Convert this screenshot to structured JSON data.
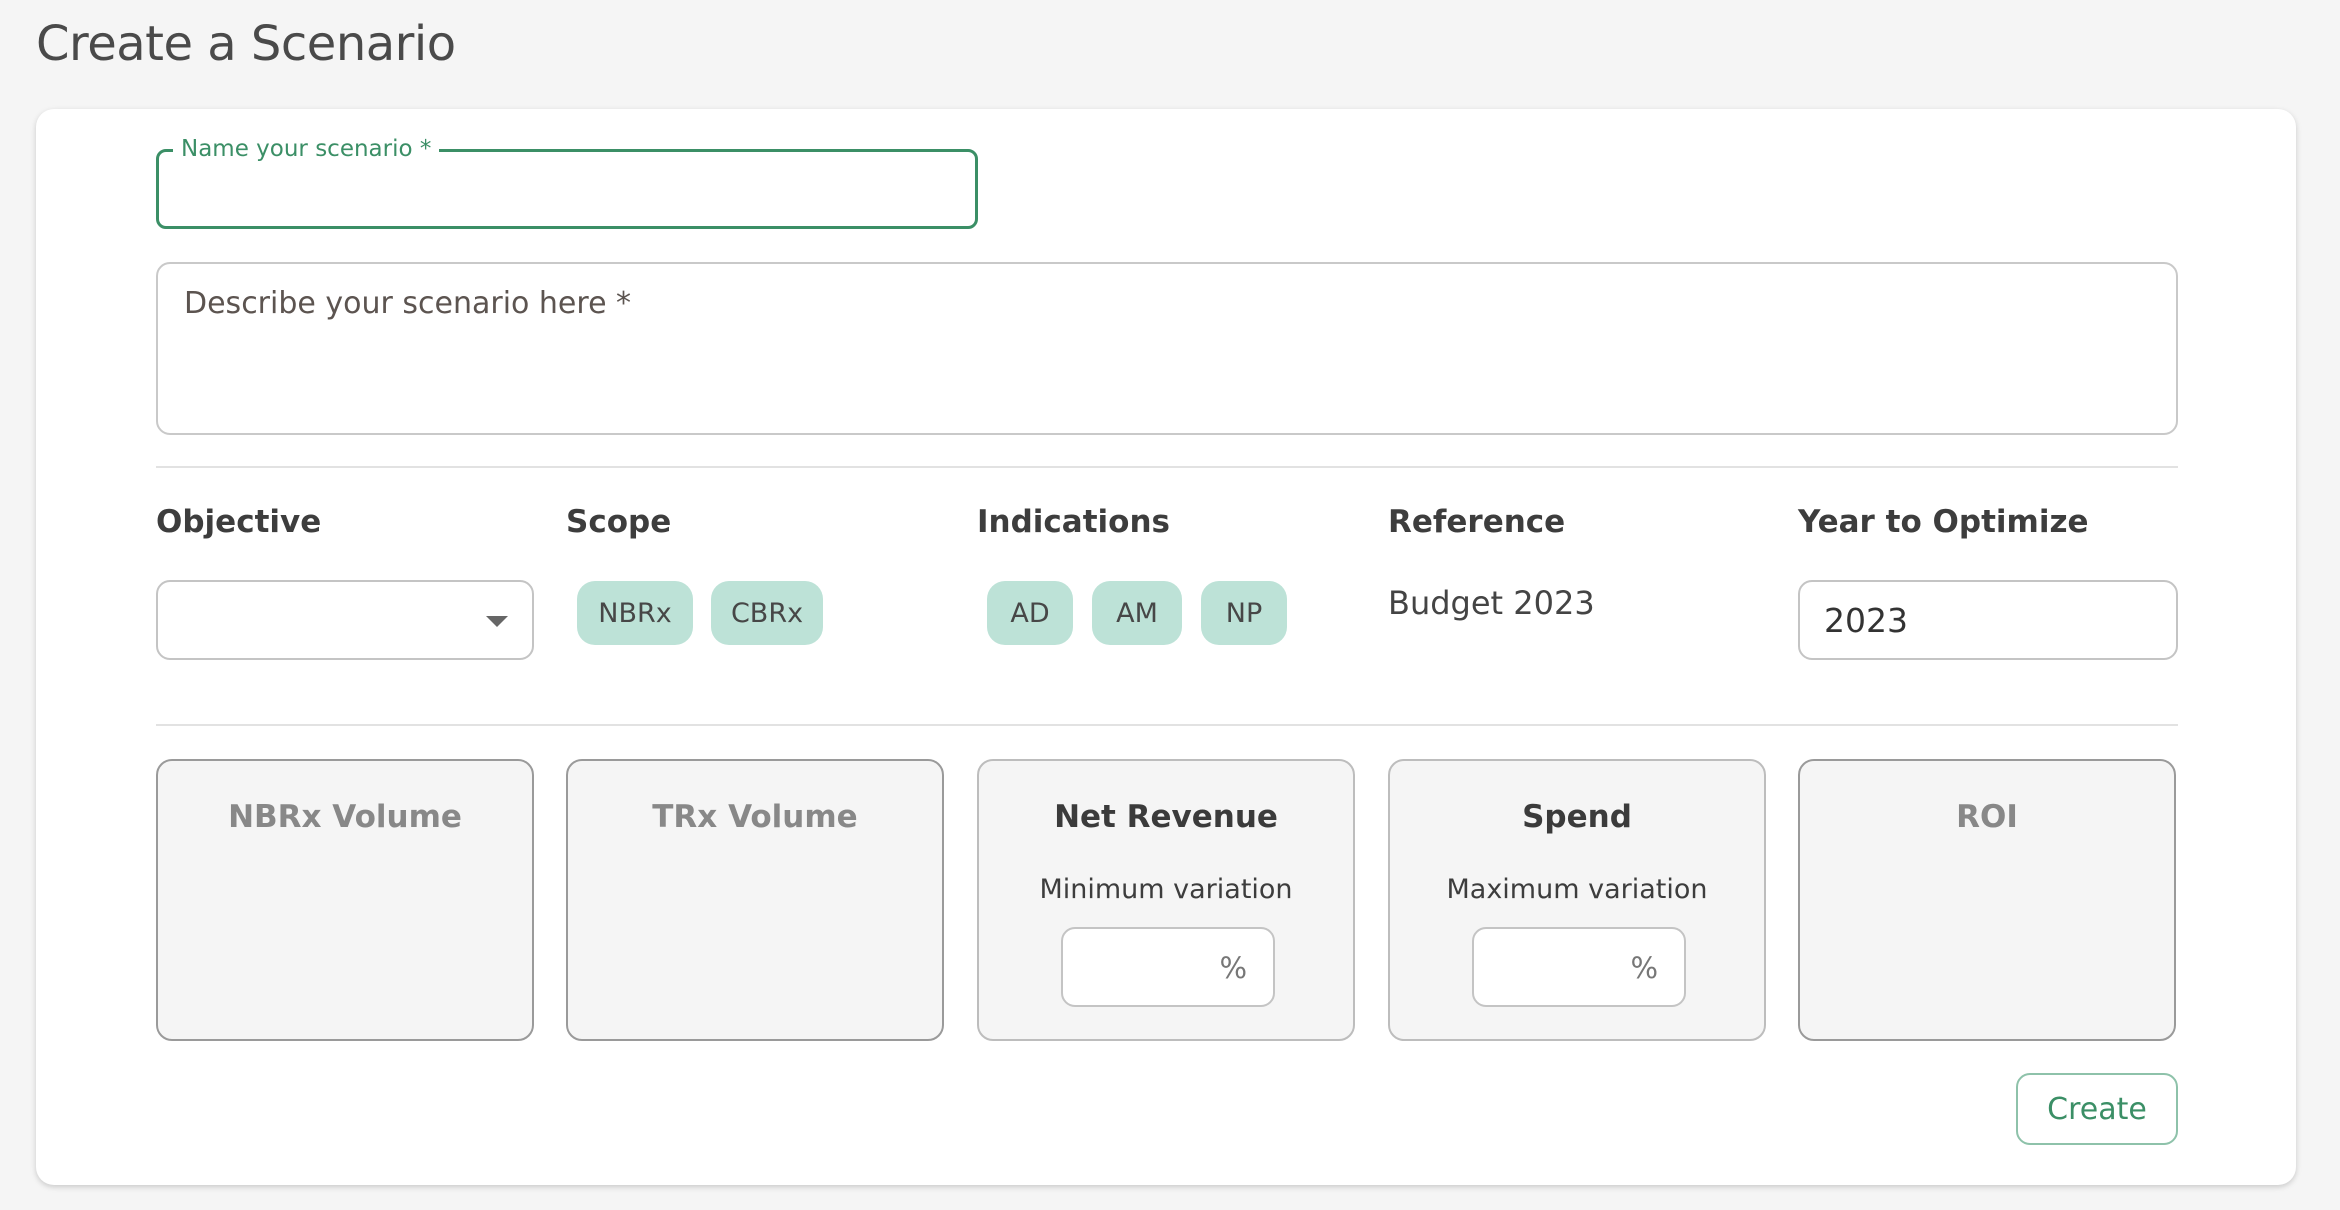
{
  "page": {
    "title": "Create a Scenario"
  },
  "form": {
    "name_label": "Name your scenario *",
    "name_value": "",
    "description_placeholder": "Describe your scenario here *",
    "description_value": ""
  },
  "columns": {
    "objective": {
      "label": "Objective",
      "selected": ""
    },
    "scope": {
      "label": "Scope",
      "chips": [
        "NBRx",
        "CBRx"
      ]
    },
    "indications": {
      "label": "Indications",
      "chips": [
        "AD",
        "AM",
        "NP"
      ]
    },
    "reference": {
      "label": "Reference",
      "value": "Budget 2023"
    },
    "year": {
      "label": "Year to Optimize",
      "value": "2023"
    }
  },
  "metrics": [
    {
      "title": "NBRx Volume"
    },
    {
      "title": "TRx Volume"
    },
    {
      "title": "Net Revenue",
      "subtitle": "Minimum variation",
      "unit": "%"
    },
    {
      "title": "Spend",
      "subtitle": "Maximum variation",
      "unit": "%"
    },
    {
      "title": "ROI"
    }
  ],
  "actions": {
    "create_label": "Create"
  },
  "colors": {
    "accent": "#3b8f66",
    "chip": "#bde2d7",
    "background": "#f5f5f5"
  },
  "icons": {
    "objective_dropdown": "caret-down-icon"
  }
}
